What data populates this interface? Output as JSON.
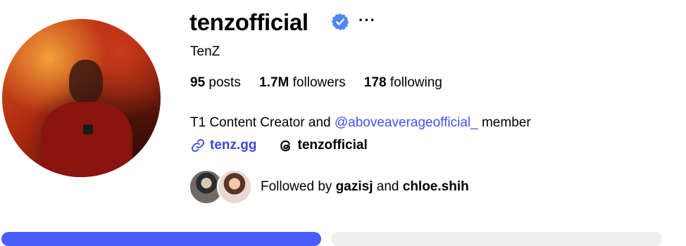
{
  "profile": {
    "username": "tenzofficial",
    "full_name": "TenZ",
    "more_label": "···",
    "stats": {
      "posts_count": "95",
      "posts_label": "posts",
      "followers_count": "1.7M",
      "followers_label": "followers",
      "following_count": "178",
      "following_label": "following"
    },
    "bio": {
      "prefix": "T1 Content Creator and ",
      "mention": "@aboveaverageofficial_",
      "suffix": " member"
    },
    "links": {
      "website": "tenz.gg",
      "threads": "tenzofficial"
    },
    "followed_by": {
      "prefix": "Followed by ",
      "user1": "gazisj",
      "joiner": " and ",
      "user2": "chloe.shih"
    }
  },
  "colors": {
    "verified_blue": "#4b88f5",
    "link_blue": "#4150f7",
    "primary_button": "#4a5df9",
    "secondary_button": "#efefef"
  },
  "icons": {
    "verified": "verified-badge-icon",
    "more": "more-options-icon",
    "link": "link-icon",
    "threads": "threads-icon"
  }
}
